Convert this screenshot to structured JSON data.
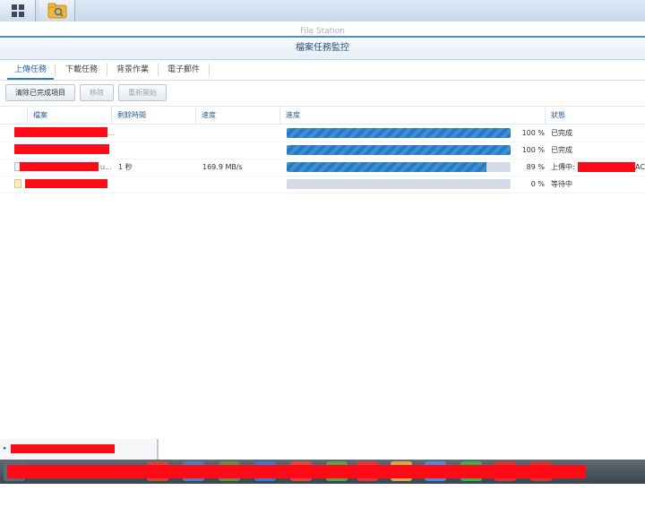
{
  "app_title": "File Station",
  "window_title": "檔案任務監控",
  "tabs": [
    {
      "label": "上傳任務",
      "active": true
    },
    {
      "label": "下載任務",
      "active": false
    },
    {
      "label": "背景作業",
      "active": false
    },
    {
      "label": "電子郵件",
      "active": false
    }
  ],
  "toolbar": {
    "clear_label": "清除已完成項目",
    "remove_label": "移除",
    "restart_label": "重新開始"
  },
  "columns": {
    "file": "檔案",
    "remaining": "剩餘時間",
    "speed": "速度",
    "progress": "進度",
    "status": "狀態"
  },
  "rows": [
    {
      "file_suffix": "...",
      "remaining": "",
      "speed": "",
      "progress": 100,
      "progress_text": "100 %",
      "status": "已完成",
      "icon": "file-icon"
    },
    {
      "file_suffix": "",
      "remaining": "",
      "speed": "",
      "progress": 100,
      "progress_text": "100 %",
      "status": "已完成",
      "icon": "file-icon"
    },
    {
      "file_suffix": "u...",
      "remaining": "1 秒",
      "speed": "169.9 MB/s",
      "progress": 89,
      "progress_text": "89 %",
      "status": "上傳中:",
      "status_suffix": "AC)",
      "icon": "file-icon"
    },
    {
      "file_suffix": "",
      "remaining": "",
      "speed": "",
      "progress": 0,
      "progress_text": "0 %",
      "status": "等待中",
      "icon": "file-icon-yellow"
    }
  ],
  "colors": {
    "accent": "#2f7ac4",
    "progress_fill": "#3c90d6",
    "progress_track": "#d4dde7",
    "redaction": "#ff0a16"
  }
}
